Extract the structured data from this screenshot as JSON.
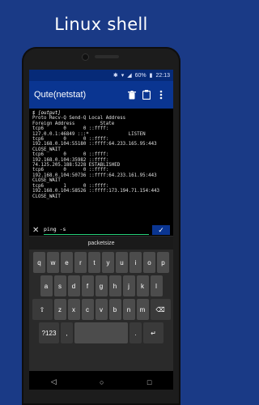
{
  "headline": "Linux shell",
  "status": {
    "battery": "60%",
    "time": "22:13"
  },
  "appbar": {
    "title": "Qute(netstat)"
  },
  "terminal": {
    "prompt": "$ [output]",
    "lines": [
      "Proto Recv-Q Send-Q Local Address",
      "Foreign Address         State",
      "tcp6       0      0 ::ffff:",
      "127.0.0.1:46849 :::*              LISTEN",
      "tcp6       0      0 ::ffff:",
      "192.168.0.104:55180 ::ffff:64.233.165.95:443",
      "CLOSE_WAIT",
      "tcp6       0      0 ::ffff:",
      "192.168.0.104:35982 ::ffff:",
      "74.125.205.188:5228 ESTABLISHED",
      "tcp6       0      0 ::ffff:",
      "192.168.0.104:50736 ::ffff:64.233.161.95:443",
      "CLOSE_WAIT",
      "tcp6       1      0 ::ffff:",
      "192.168.0.104:58526 ::ffff:173.194.71.154:443",
      "CLOSE_WAIT"
    ]
  },
  "input": {
    "value": "ping -s"
  },
  "suggestion": "packetsize",
  "keyboard": {
    "row1": [
      "q",
      "w",
      "e",
      "r",
      "t",
      "y",
      "u",
      "i",
      "o",
      "p"
    ],
    "row2": [
      "a",
      "s",
      "d",
      "f",
      "g",
      "h",
      "j",
      "k",
      "l"
    ],
    "row3": [
      "z",
      "x",
      "c",
      "v",
      "b",
      "n",
      "m"
    ],
    "shift": "⇧",
    "backspace": "⌫",
    "sym": "?123",
    "comma": ",",
    "period": ".",
    "enter": "↵"
  },
  "navbar": {
    "back": "◁",
    "home": "○",
    "recents": "□"
  }
}
